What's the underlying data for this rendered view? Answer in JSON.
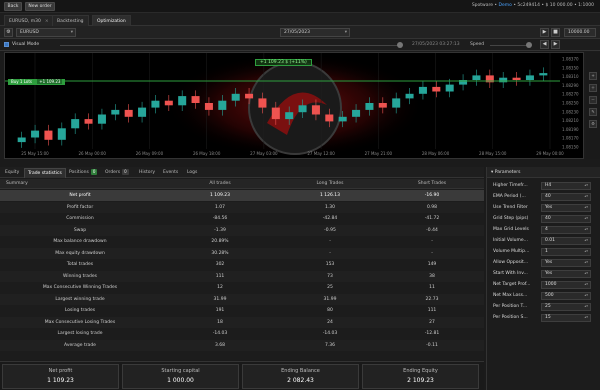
{
  "top": {
    "back_label": "Back",
    "new_label": "New order",
    "status_prefix": "Spotware • ",
    "status_blue": "Demo",
    "status_rest": " • 5c249414 • $ 10 000.00 • 1:1000"
  },
  "tabs": [
    {
      "label": "EURUSD, m30"
    },
    {
      "label": "Backtesting"
    },
    {
      "label": "Optimization"
    }
  ],
  "toolbar": {
    "symbol": "EURUSD",
    "date": "27/05/2023",
    "capital": "10000.00"
  },
  "row2": {
    "visual_mode": "Visual Mode",
    "date_text": "27/05/2023 03:27:13",
    "speed_label": "Speed"
  },
  "chart": {
    "banner": "+1 109.23 $ (+11%)",
    "price_labels": [
      "1.08370",
      "1.08350",
      "1.08310",
      "1.08290",
      "1.08270",
      "1.08250",
      "1.08230",
      "1.08210",
      "1.08190",
      "1.08170",
      "1.08150"
    ],
    "date_labels": [
      "25 May 15:00",
      "26 May 00:00",
      "26 May 09:00",
      "26 May 18:00",
      "27 May 03:00",
      "27 May 12:00",
      "27 May 21:00",
      "28 May 06:00",
      "28 May 15:00",
      "29 May 00:00"
    ],
    "order_line_label": "Buy 1 Lots",
    "order_line_tag": "+1 109.23"
  },
  "chart_data": {
    "type": "line",
    "title": "",
    "series": [
      {
        "values": [
          1.082,
          1.0823,
          1.0819,
          1.0824,
          1.0828,
          1.0826,
          1.083,
          1.0832,
          1.0829,
          1.0833,
          1.0836,
          1.0834,
          1.0838,
          1.0835,
          1.0832,
          1.0836,
          1.0839,
          1.0837,
          1.0833,
          1.0828,
          1.0831,
          1.0834,
          1.083,
          1.0827,
          1.0829,
          1.0832,
          1.0835,
          1.0833,
          1.0837,
          1.0839,
          1.0842,
          1.084,
          1.0843,
          1.0845,
          1.0847,
          1.0844,
          1.0846,
          1.0845,
          1.0847,
          1.0848
        ]
      }
    ],
    "ylim": [
      1.0815,
      1.0855
    ]
  },
  "stat_tabs": [
    {
      "label": "Equity"
    },
    {
      "label": "Trade statistics"
    },
    {
      "label": "Positions",
      "badge": "0"
    },
    {
      "label": "Orders",
      "badge": "0"
    },
    {
      "label": "History"
    },
    {
      "label": "Events"
    },
    {
      "label": "Logs"
    }
  ],
  "table": {
    "headers": {
      "label": "Summary",
      "all": "All trades",
      "long": "Long Trades",
      "short": "Short Trades"
    },
    "rows": [
      {
        "label": "Net profit",
        "all": "1 109.23",
        "long": "1 126.13",
        "short": "-16.90"
      },
      {
        "label": "Profit factor",
        "all": "1.07",
        "long": "1.30",
        "short": "0.98"
      },
      {
        "label": "Commission",
        "all": "-84.56",
        "long": "-42.84",
        "short": "-41.72"
      },
      {
        "label": "Swap",
        "all": "-1.39",
        "long": "-0.95",
        "short": "-0.44"
      },
      {
        "label": "Max balance drawdown",
        "all": "20.89%",
        "long": "-",
        "short": "-"
      },
      {
        "label": "Max equity drawdown",
        "all": "30.28%",
        "long": "-",
        "short": "-"
      },
      {
        "label": "Total trades",
        "all": "302",
        "long": "153",
        "short": "149"
      },
      {
        "label": "Winning trades",
        "all": "111",
        "long": "73",
        "short": "38"
      },
      {
        "label": "Max Consecutive Winning Trades",
        "all": "12",
        "long": "25",
        "short": "11"
      },
      {
        "label": "Largest winning trade",
        "all": "31.99",
        "long": "31.99",
        "short": "22.73"
      },
      {
        "label": "Losing trades",
        "all": "191",
        "long": "80",
        "short": "111"
      },
      {
        "label": "Max Consecutive Losing Trades",
        "all": "18",
        "long": "24",
        "short": "27"
      },
      {
        "label": "Largest losing trade",
        "all": "-14.03",
        "long": "-14.03",
        "short": "-12.81"
      },
      {
        "label": "Average trade",
        "all": "3.68",
        "long": "7.36",
        "short": "-0.11"
      }
    ]
  },
  "summary": [
    {
      "label": "Net profit",
      "value": "1 109.23"
    },
    {
      "label": "Starting capital",
      "value": "1 000.00"
    },
    {
      "label": "Ending Balance",
      "value": "2 082.43"
    },
    {
      "label": "Ending Equity",
      "value": "2 109.23"
    }
  ],
  "params": {
    "title": "Parameters",
    "rows": [
      {
        "label": "Higher Timefr...",
        "value": "H4"
      },
      {
        "label": "EMA Period (...",
        "value": "40"
      },
      {
        "label": "Use Trend Filter",
        "value": "Yes"
      },
      {
        "label": "Grid Step (pips)",
        "value": "40"
      },
      {
        "label": "Max Grid Levels",
        "value": "4"
      },
      {
        "label": "Initial Volume...",
        "value": "0.01"
      },
      {
        "label": "Volume Multip...",
        "value": "1"
      },
      {
        "label": "Allow Opposit...",
        "value": "Yes"
      },
      {
        "label": "Start With Inv...",
        "value": "Yes"
      },
      {
        "label": "Net Target Prof...",
        "value": "1000"
      },
      {
        "label": "Net Max Loss...",
        "value": "500"
      },
      {
        "label": "Per Position T...",
        "value": "25"
      },
      {
        "label": "Per Position S...",
        "value": "15"
      }
    ]
  },
  "colors": {
    "bull": "#26a69a",
    "bear": "#ef5350",
    "order_line": "#2e9e3e",
    "accent": "#4aa3ff"
  }
}
